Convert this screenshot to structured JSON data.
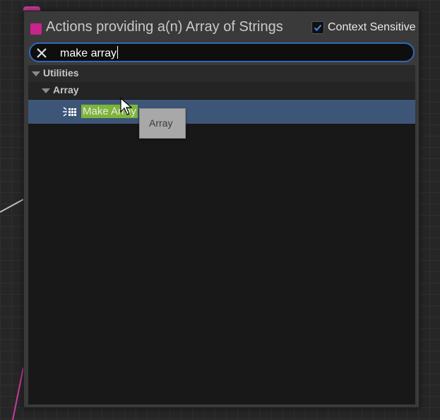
{
  "header": {
    "title": "Actions providing a(n) Array of Strings",
    "context_sensitive_label": "Context Sensitive",
    "context_sensitive_checked": true,
    "accent_color": "#c8238f"
  },
  "search": {
    "value": "make array"
  },
  "tree": {
    "categories": [
      {
        "label": "Utilities",
        "expanded": true,
        "subcategories": [
          {
            "label": "Array",
            "expanded": true,
            "items": [
              {
                "label": "Make Array",
                "selected": true,
                "icon": "make-array-node-icon",
                "match_highlight": "#7db43a"
              }
            ]
          }
        ]
      }
    ],
    "selection_color": "#3d5577"
  },
  "tooltip": {
    "text": "Array"
  }
}
